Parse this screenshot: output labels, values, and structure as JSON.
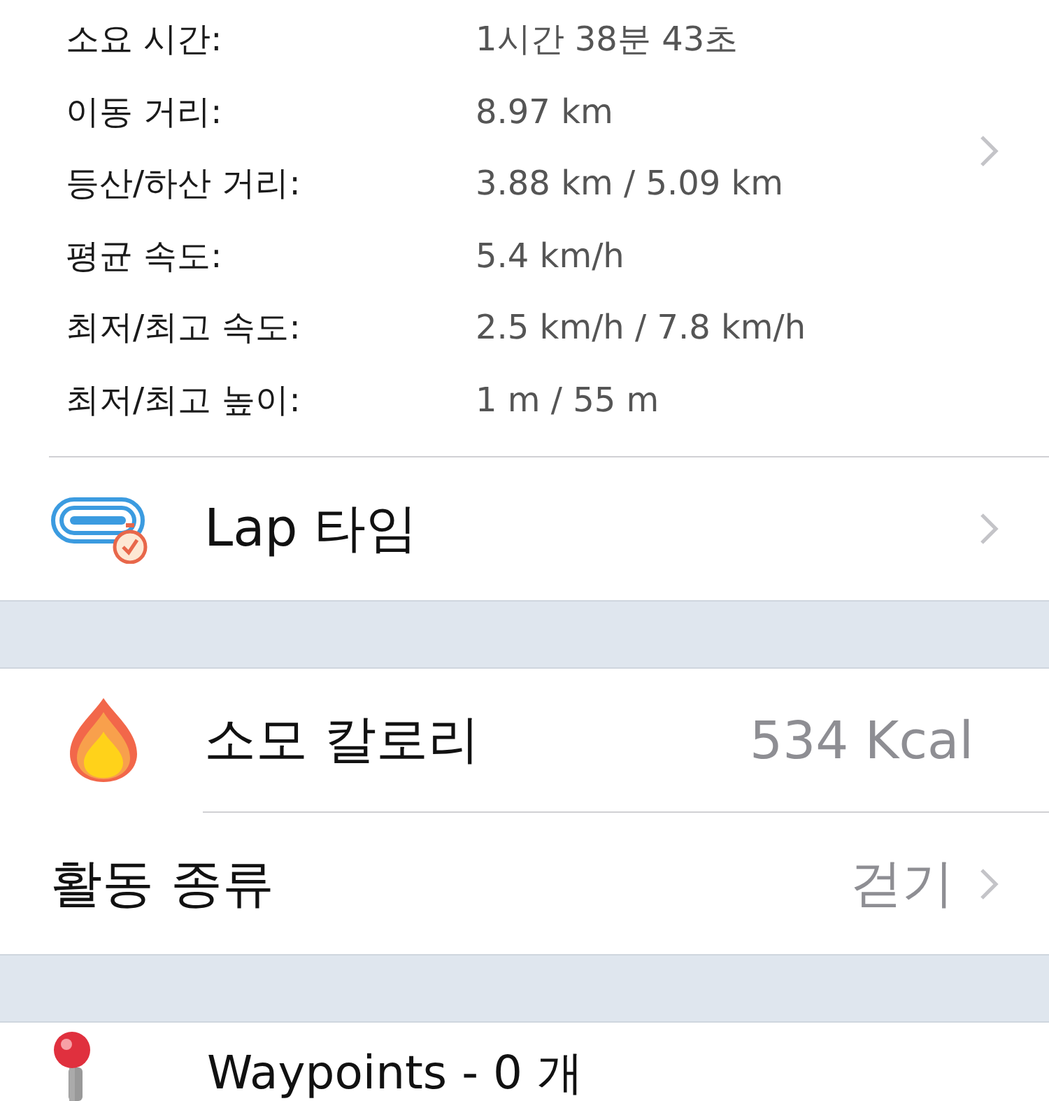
{
  "stats": {
    "rows": [
      {
        "label": "소요 시간:",
        "value": "1시간 38분 43초"
      },
      {
        "label": "이동 거리:",
        "value": "8.97 km"
      },
      {
        "label": "등산/하산 거리:",
        "value": "3.88 km / 5.09 km"
      },
      {
        "label": "평균 속도:",
        "value": "5.4 km/h"
      },
      {
        "label": "최저/최고 속도:",
        "value": "2.5 km/h / 7.8 km/h"
      },
      {
        "label": "최저/최고 높이:",
        "value": "1 m / 55 m"
      }
    ],
    "disclosure": true
  },
  "sections": [
    {
      "rows": [
        {
          "kind": "lap",
          "label": "Lap 타임",
          "disclosure": true
        }
      ]
    },
    {
      "rows": [
        {
          "kind": "calories",
          "label": "소모 칼로리",
          "value": "534 Kcal",
          "disclosure": false
        },
        {
          "kind": "plain",
          "label": "활동 종류",
          "value": "걷기",
          "disclosure": true
        }
      ]
    },
    {
      "rows": [
        {
          "kind": "waypoints",
          "label": "Waypoints - 0 개",
          "disclosure": false
        }
      ]
    }
  ]
}
